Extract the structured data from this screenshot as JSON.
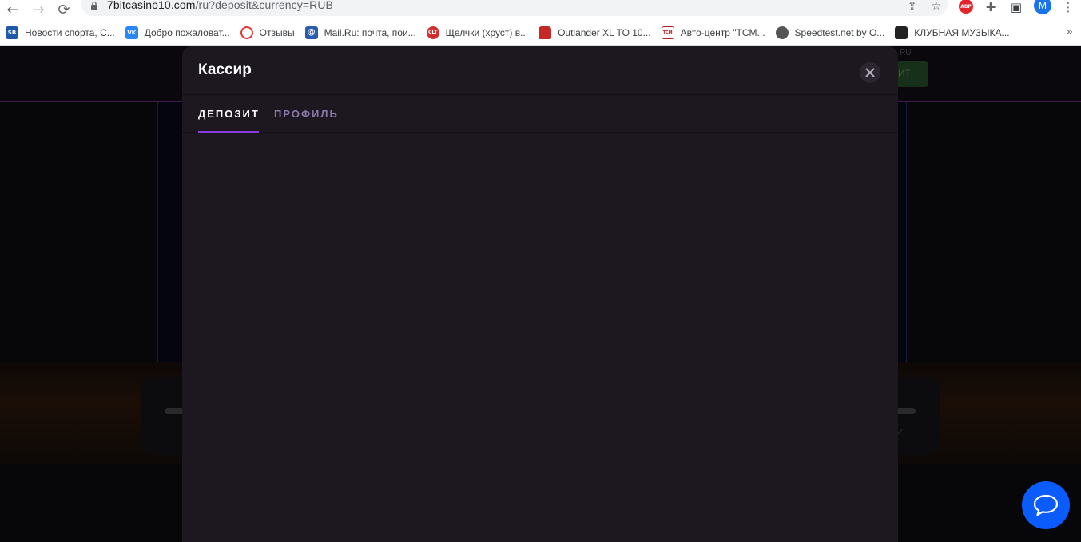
{
  "browser": {
    "url_host": "7bitcasino10.com",
    "url_path": "/ru?deposit&currency=RUB",
    "profile_initial": "M",
    "abp_label": "ABP",
    "bookmarks": [
      {
        "label": "Новости спорта, С...",
        "icon_text": "SB",
        "icon_color": "#1e5aa8"
      },
      {
        "label": "Добро пожаловат...",
        "icon_text": "VK",
        "icon_color": "#2787f5"
      },
      {
        "label": "Отзывы",
        "icon_text": "",
        "icon_color": "#e53935"
      },
      {
        "label": "Mail.Ru: почта, пои...",
        "icon_text": "@",
        "icon_color": "#2a5db0"
      },
      {
        "label": "Щелчки (хруст) в...",
        "icon_text": "CLT",
        "icon_color": "#d32f2f"
      },
      {
        "label": "Outlander XL TO 10...",
        "icon_text": "",
        "icon_color": "#c62828"
      },
      {
        "label": "Авто-центр \"TCM...",
        "icon_text": "TCM",
        "icon_color": "#b71c1c"
      },
      {
        "label": "Speedtest.net by O...",
        "icon_text": "",
        "icon_color": "#555555"
      },
      {
        "label": "КЛУБНАЯ МУЗЫКА...",
        "icon_text": "",
        "icon_color": "#222222"
      }
    ]
  },
  "page": {
    "lang": "RU",
    "header_button": "ИТ"
  },
  "modal": {
    "title": "Кассир",
    "tabs": {
      "deposit": "ДЕПОЗИТ",
      "profile": "ПРОФИЛЬ"
    }
  },
  "colors": {
    "modal_bg": "#1d1720",
    "tab_accent": "#8b3bd9",
    "chat_bg": "#0a5cff"
  }
}
